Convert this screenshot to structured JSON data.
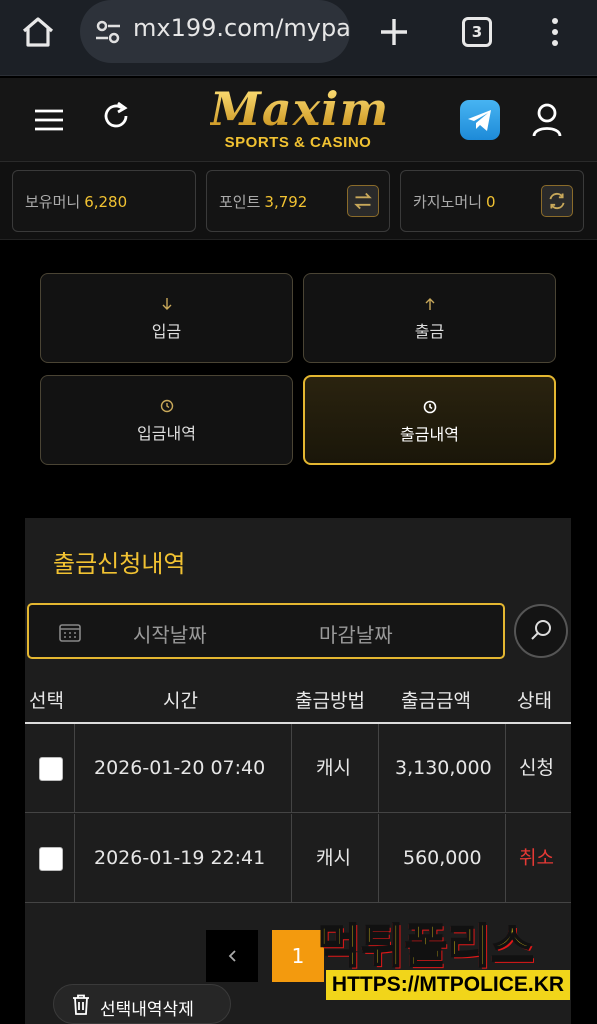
{
  "browser": {
    "url": "mx199.com/mypa",
    "tab_count": "3"
  },
  "brand": {
    "logo_main": "Maxim",
    "logo_sub": "SPORTS & CASINO"
  },
  "balances": [
    {
      "label": "보유머니",
      "value": "6,280"
    },
    {
      "label": "포인트",
      "value": "3,792"
    },
    {
      "label": "카지노머니",
      "value": "0"
    }
  ],
  "actions": {
    "deposit": "입금",
    "withdraw": "출금",
    "deposit_history": "입금내역",
    "withdraw_history": "출금내역"
  },
  "panel": {
    "title": "출금신청내역",
    "start_date_placeholder": "시작날짜",
    "end_date_placeholder": "마감날짜"
  },
  "table": {
    "headers": [
      "선택",
      "시간",
      "출금방법",
      "출금금액",
      "상태"
    ],
    "rows": [
      {
        "time": "2026-01-20 07:40",
        "method": "캐시",
        "amount": "3,130,000",
        "status": "신청"
      },
      {
        "time": "2026-01-19 22:41",
        "method": "캐시",
        "amount": "560,000",
        "status": "취소"
      }
    ]
  },
  "pagination": {
    "prev": "‹",
    "current": "1"
  },
  "delete_selected": "선택내역삭제",
  "watermark": {
    "title": "먹튀폴리스",
    "url": "HTTPS://MTPOLICE.KR"
  },
  "colors": {
    "accent": "#f1c232",
    "status_cancel": "#e53935",
    "page_active": "#f39a0e"
  }
}
